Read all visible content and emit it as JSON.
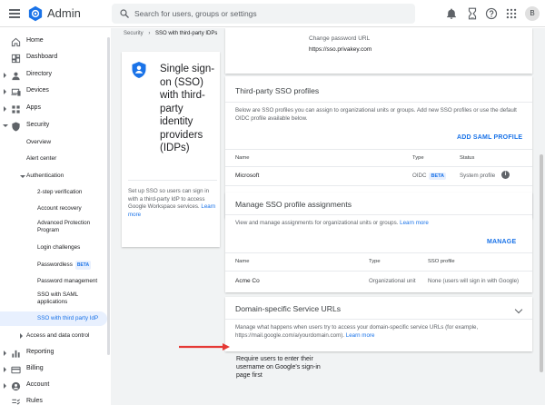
{
  "header": {
    "app_title": "Admin",
    "search_placeholder": "Search for users, groups or settings",
    "avatar_letter": "B",
    "brand_color": "#1a73e8"
  },
  "sidebar": {
    "items": [
      {
        "label": "Home",
        "icon": "home-icon"
      },
      {
        "label": "Dashboard",
        "icon": "dashboard-icon"
      },
      {
        "label": "Directory",
        "icon": "person-icon"
      },
      {
        "label": "Devices",
        "icon": "devices-icon"
      },
      {
        "label": "Apps",
        "icon": "apps-icon"
      },
      {
        "label": "Security",
        "icon": "shield-icon"
      },
      {
        "label": "Reporting",
        "icon": "bar-chart-icon"
      },
      {
        "label": "Billing",
        "icon": "credit-card-icon"
      },
      {
        "label": "Account",
        "icon": "account-circle-icon"
      },
      {
        "label": "Rules",
        "icon": "rules-icon"
      }
    ],
    "security_sub": {
      "overview": "Overview",
      "alert_center": "Alert center",
      "authentication": "Authentication",
      "access_data_control": "Access and data control"
    },
    "auth_sub": {
      "two_step": "2-step verification",
      "account_recovery": "Account recovery",
      "advanced_protection": "Advanced Protection Program",
      "login_challenges": "Login challenges",
      "passwordless": "Passwordless",
      "passwordless_badge": "BETA",
      "password_management": "Password management",
      "sso_saml": "SSO with SAML applications",
      "sso_third_party": "SSO with third party IdP"
    }
  },
  "breadcrumb": {
    "root": "Security",
    "separator": "›",
    "current": "SSO with third-party IDPs"
  },
  "info_card": {
    "title": "Single sign-on (SSO) with third-party identity providers (IDPs)",
    "description": "Set up SSO so users can sign in with a third-party IdP to access Google Workspace services.",
    "learn_more": "Learn more"
  },
  "change_password": {
    "label": "Change password URL",
    "url": "https://sso.privakey.com"
  },
  "third_party": {
    "title": "Third-party SSO profiles",
    "description": "Below are SSO profiles you can assign to organizational units or groups. Add new SSO profiles or use the default OIDC profile available below.",
    "add_button": "ADD SAML PROFILE",
    "columns": {
      "name": "Name",
      "type": "Type",
      "status": "Status"
    },
    "rows": [
      {
        "name": "Microsoft",
        "type": "OIDC",
        "badge": "BETA",
        "status": "System profile",
        "info": "i"
      }
    ]
  },
  "assignments": {
    "title": "Manage SSO profile assignments",
    "description": "View and manage assignments for organizational units or groups.",
    "learn_more": "Learn more",
    "manage_button": "MANAGE",
    "columns": {
      "name": "Name",
      "type": "Type",
      "sso": "SSO profile"
    },
    "rows": [
      {
        "name": "Acme Co",
        "type": "Organizational unit",
        "sso": "None (users will sign in with Google)"
      }
    ]
  },
  "domain_urls": {
    "title": "Domain-specific Service URLs",
    "description": "Manage what happens when users try to access your domain-specific service URLs (for example, https://mail.google.com/a/yourdomain.com).",
    "learn_more": "Learn more"
  },
  "annotation": {
    "text": "Require users to enter their username on Google's sign-in page first",
    "arrow_color": "#e53935"
  }
}
